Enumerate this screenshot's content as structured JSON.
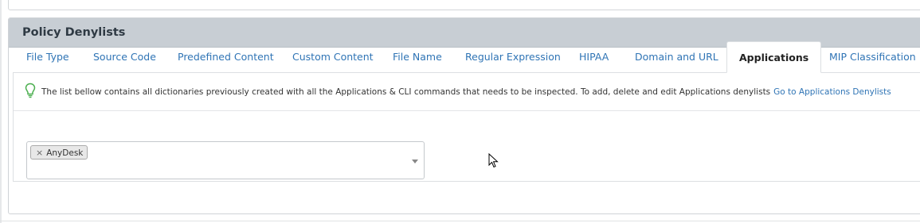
{
  "panel": {
    "title": "Policy Denylists"
  },
  "tabs": [
    {
      "label": "File Type",
      "active": false
    },
    {
      "label": "Source Code",
      "active": false
    },
    {
      "label": "Predefined Content",
      "active": false
    },
    {
      "label": "Custom Content",
      "active": false
    },
    {
      "label": "File Name",
      "active": false
    },
    {
      "label": "Regular Expression",
      "active": false
    },
    {
      "label": "HIPAA",
      "active": false
    },
    {
      "label": "Domain and URL",
      "active": false
    },
    {
      "label": "Applications",
      "active": true
    },
    {
      "label": "MIP Classification",
      "active": false
    }
  ],
  "info": {
    "icon": "lightbulb-icon",
    "text": "The list bellow contains all dictionaries previously created with all the Applications & CLI commands that needs to be inspected. To add, delete and edit Applications denylists",
    "link_text": "Go to Applications Denylists"
  },
  "selector": {
    "selected": [
      "AnyDesk"
    ],
    "remove_glyph": "×",
    "icon": "chevron-down-icon"
  },
  "colors": {
    "header_bg": "#c8ced4",
    "link": "#2f74b5",
    "bulb": "#4caf50"
  }
}
